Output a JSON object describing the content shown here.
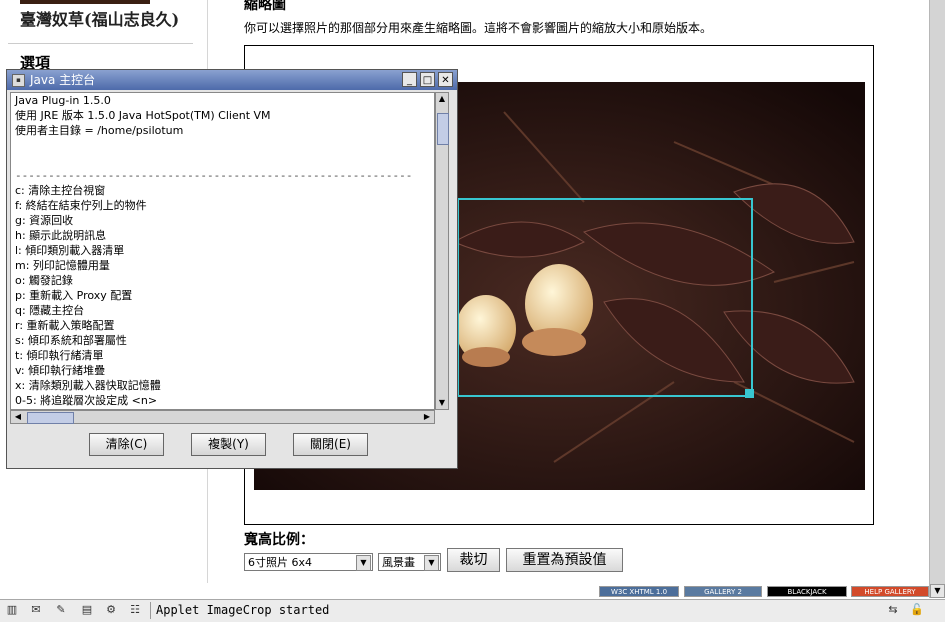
{
  "sidebar": {
    "title": "臺灣奴草(福山志良久)",
    "options_heading": "選項"
  },
  "main": {
    "section_heading": "縮略圖",
    "description": "你可以選擇照片的那個部分用來產生縮略圖。這將不會影響圖片的縮放大小和原始版本。",
    "ratio_label": "寬高比例：",
    "ratio_select_value": "6寸照片 6x4",
    "type_select_value": "風景畫",
    "crop_button": "裁切",
    "reset_button": "重置為預設值"
  },
  "badges": {
    "w3c": "W3C XHTML 1.0",
    "gallery2": "GALLERY 2",
    "blackjack": "BLACKJACK",
    "help_gallery": "HELP GALLERY"
  },
  "statusbar": {
    "text": "Applet ImageCrop started"
  },
  "console": {
    "title": "Java 主控台",
    "lines": [
      "Java Plug-in 1.5.0",
      "使用 JRE 版本 1.5.0 Java HotSpot(TM) Client VM",
      "使用者主目錄 = /home/psilotum",
      "",
      "",
      "",
      "c:   清除主控台視窗",
      "f:   終結在結束佇列上的物件",
      "g:   資源回收",
      "h:   顯示此說明訊息",
      "l:   傾印類別載入器清單",
      "m:   列印記憶體用量",
      "o:   觸發記錄",
      "p:   重新載入 Proxy 配置",
      "q:   隱藏主控台",
      "r:   重新載入策略配置",
      "s:   傾印系統和部署屬性",
      "t:   傾印執行緒清單",
      "v:   傾印執行緒堆疊",
      "x:   清除類別載入器快取記憶體",
      "0-5: 將追蹤層次設定成 <n>"
    ],
    "rule": "------------------------------------------------------------",
    "clear_button": "清除(C)",
    "copy_button": "複製(Y)",
    "close_button": "關閉(E)"
  },
  "colors": {
    "selection": "#38c6d0",
    "titlebar": "#4d6aaa"
  }
}
